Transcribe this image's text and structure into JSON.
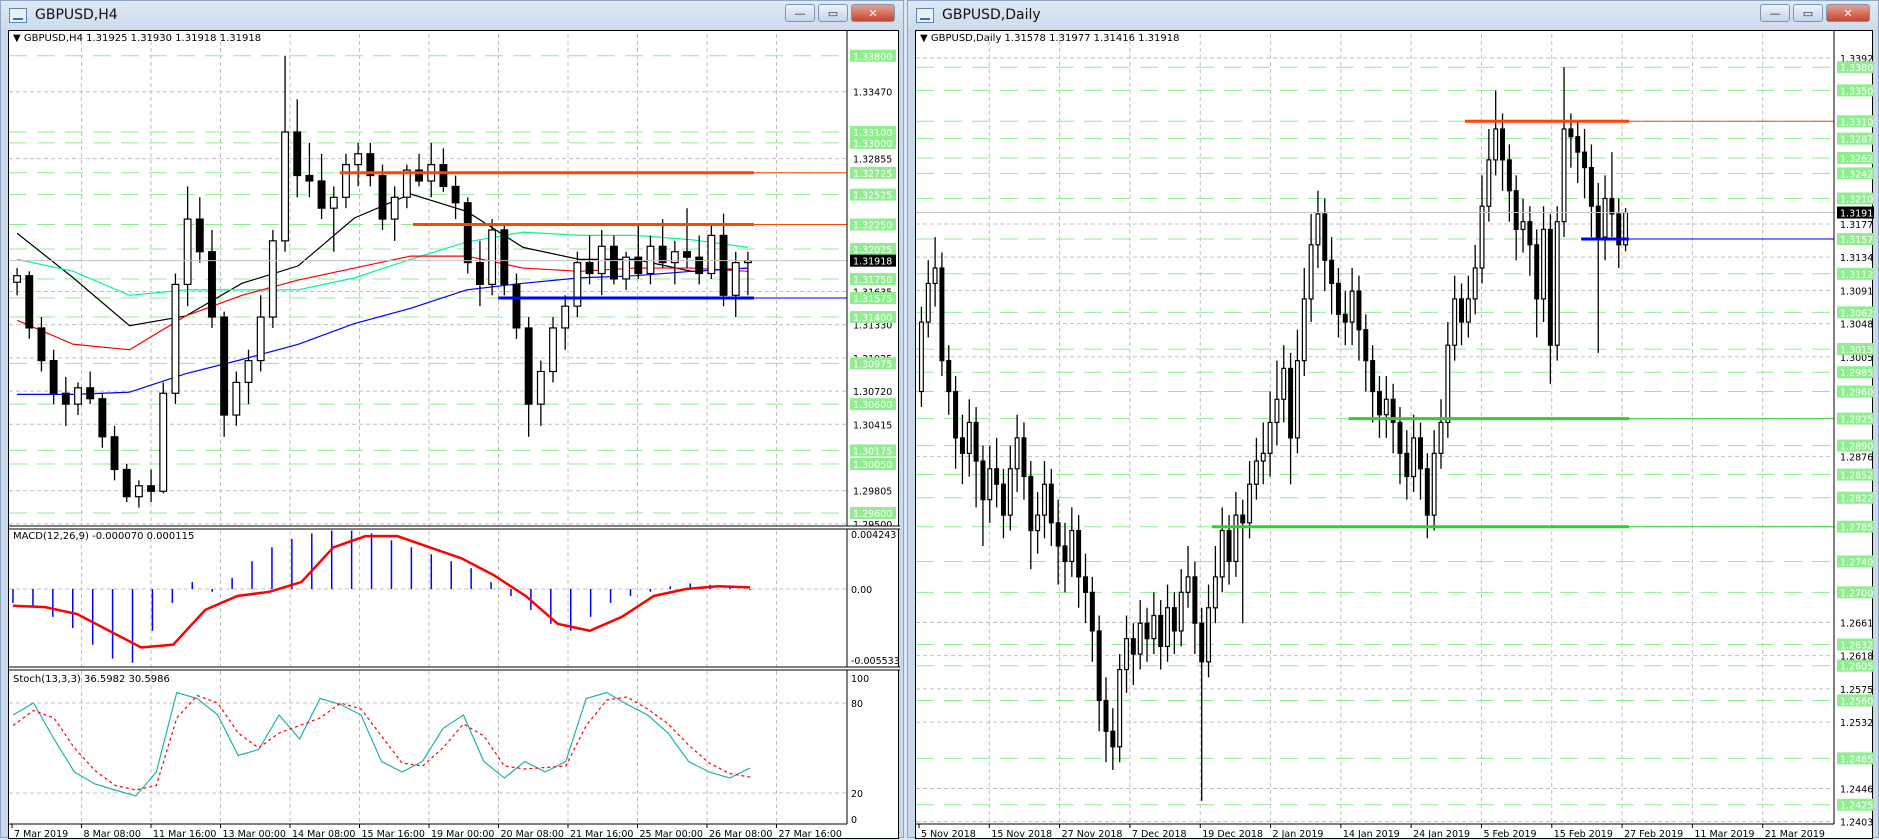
{
  "colors": {
    "bull": "#ffffff",
    "bear": "#000000",
    "level": "#90ee90",
    "grid": "#c0c0c0",
    "orange": "#ff4500",
    "blue": "#0000ff",
    "green": "#32cd32",
    "ma_black": "#000000",
    "ma_teal": "#00fa9a",
    "ma_red": "#ff0000",
    "ma_blue": "#0000ff",
    "macd_hist": "#0000ff",
    "macd_signal": "#ff0000",
    "stoch_main": "#20b2aa",
    "stoch_signal": "#ff0000"
  },
  "h4": {
    "window_title": "GBPUSD,H4",
    "legend": "GBPUSD,H4  1.31925 1.31930 1.31918 1.31918",
    "buttons": {
      "minimize": "—",
      "restore": "▭",
      "close": "✕"
    },
    "chart_data": {
      "type": "candlestick",
      "ylim": [
        1.2949,
        1.34
      ],
      "first_open": 1.3172,
      "close": [
        1.3178,
        1.313,
        1.31,
        1.307,
        1.306,
        1.3075,
        1.3065,
        1.303,
        1.3,
        1.2975,
        1.2985,
        1.298,
        1.307,
        1.317,
        1.323,
        1.32,
        1.314,
        1.305,
        1.308,
        1.31,
        1.314,
        1.321,
        1.331,
        1.327,
        1.3265,
        1.324,
        1.325,
        1.328,
        1.329,
        1.327,
        1.323,
        1.325,
        1.3275,
        1.3265,
        1.328,
        1.326,
        1.3245,
        1.319,
        1.317,
        1.322,
        1.317,
        1.313,
        1.306,
        1.309,
        1.313,
        1.315,
        1.319,
        1.318,
        1.3205,
        1.3175,
        1.3195,
        1.318,
        1.3205,
        1.319,
        1.32,
        1.3195,
        1.318,
        1.3215,
        1.316,
        1.319,
        1.31918
      ],
      "high": [
        1.3185,
        1.3182,
        1.314,
        1.311,
        1.3085,
        1.308,
        1.309,
        1.307,
        1.304,
        1.3005,
        1.299,
        1.3,
        1.308,
        1.318,
        1.326,
        1.325,
        1.322,
        1.3145,
        1.309,
        1.311,
        1.316,
        1.322,
        1.338,
        1.334,
        1.33,
        1.329,
        1.326,
        1.329,
        1.33,
        1.33,
        1.328,
        1.326,
        1.328,
        1.329,
        1.33,
        1.3295,
        1.327,
        1.325,
        1.321,
        1.323,
        1.3225,
        1.318,
        1.314,
        1.31,
        1.314,
        1.316,
        1.32,
        1.3215,
        1.322,
        1.3215,
        1.32,
        1.3225,
        1.3215,
        1.323,
        1.321,
        1.324,
        1.3215,
        1.3225,
        1.3235,
        1.32,
        1.32
      ],
      "low": [
        1.316,
        1.312,
        1.309,
        1.306,
        1.304,
        1.305,
        1.306,
        1.302,
        1.299,
        1.297,
        1.2965,
        1.297,
        1.2978,
        1.306,
        1.315,
        1.319,
        1.313,
        1.303,
        1.304,
        1.306,
        1.309,
        1.313,
        1.32,
        1.325,
        1.325,
        1.323,
        1.32,
        1.324,
        1.326,
        1.326,
        1.322,
        1.321,
        1.324,
        1.326,
        1.325,
        1.3255,
        1.323,
        1.318,
        1.315,
        1.316,
        1.316,
        1.312,
        1.303,
        1.304,
        1.308,
        1.311,
        1.314,
        1.317,
        1.316,
        1.317,
        1.3165,
        1.3175,
        1.317,
        1.3185,
        1.317,
        1.3185,
        1.317,
        1.3175,
        1.315,
        1.314,
        1.316
      ],
      "moving_averages": [
        {
          "name": "ma-black",
          "color": "#000000",
          "values": [
            1.3217,
            1.3176,
            1.3132,
            1.3141,
            1.3171,
            1.3187,
            1.3231,
            1.3253,
            1.3237,
            1.3204,
            1.3193,
            1.3193,
            1.3182,
            1.3185
          ]
        },
        {
          "name": "ma-teal",
          "color": "#00fa9a",
          "values": [
            1.3193,
            1.3182,
            1.316,
            1.3165,
            1.3165,
            1.3165,
            1.3176,
            1.3193,
            1.3209,
            1.3218,
            1.3215,
            1.3215,
            1.3211,
            1.3204
          ]
        },
        {
          "name": "ma-red",
          "color": "#ff0000",
          "values": [
            1.3137,
            1.3115,
            1.311,
            1.3141,
            1.316,
            1.3174,
            1.3185,
            1.3196,
            1.3196,
            1.3185,
            1.3182,
            1.3185,
            1.3185,
            1.3182
          ]
        },
        {
          "name": "ma-blue",
          "color": "#0000ff",
          "values": [
            1.3069,
            1.3069,
            1.3071,
            1.3088,
            1.3101,
            1.3115,
            1.3134,
            1.3148,
            1.3165,
            1.3171,
            1.3176,
            1.3178,
            1.3182,
            1.3185
          ]
        }
      ],
      "hlines": [
        {
          "name": "resistance-line-upper",
          "price": 1.32725,
          "color": "#ff4500",
          "from_index": 27
        },
        {
          "name": "resistance-line-lower",
          "price": 1.3225,
          "color": "#ff4500",
          "from_index": 33
        },
        {
          "name": "support-line",
          "price": 1.31575,
          "color": "#0000ff",
          "from_index": 40
        }
      ],
      "level_labels": [
        "1.33800",
        "1.33100",
        "1.33000",
        "1.32725",
        "1.32525",
        "1.32250",
        "1.32025",
        "1.31750",
        "1.31575",
        "1.31400",
        "1.30975",
        "1.30600",
        "1.30175",
        "1.30050",
        "1.29600"
      ],
      "price_labels": [
        "1.33470",
        "1.32855",
        "1.31635",
        "1.31330",
        "1.31025",
        "1.30720",
        "1.30415",
        "1.29805",
        "1.29500"
      ],
      "current_price": "1.31918",
      "time_labels": [
        "7 Mar 2019",
        "8 Mar 08:00",
        "11 Mar 16:00",
        "13 Mar 00:00",
        "14 Mar 08:00",
        "15 Mar 16:00",
        "19 Mar 00:00",
        "20 Mar 08:00",
        "21 Mar 16:00",
        "25 Mar 00:00",
        "26 Mar 08:00",
        "27 Mar 16:00"
      ]
    },
    "macd": {
      "legend": "MACD(12,26,9) -0.000070 0.000115",
      "ylim": [
        -0.005533,
        0.004243
      ],
      "axis_labels": [
        "0.004243",
        "0.00",
        "-0.005533"
      ],
      "histogram": [
        -0.001,
        -0.0012,
        -0.002,
        -0.0028,
        -0.004,
        -0.005,
        -0.0053,
        -0.003,
        -0.001,
        0.0005,
        -0.0002,
        0.0008,
        0.002,
        0.003,
        0.0036,
        0.004,
        0.0042,
        0.0042,
        0.004,
        0.0035,
        0.003,
        0.0025,
        0.002,
        0.0015,
        0.0005,
        -0.0005,
        -0.0015,
        -0.0025,
        -0.003,
        -0.002,
        -0.001,
        -0.0005,
        -0.0002,
        0.0002,
        0.0004,
        0.0003,
        0.0002,
        -7e-05
      ],
      "signal": [
        -0.0012,
        -0.0013,
        -0.0018,
        -0.003,
        -0.0042,
        -0.004,
        -0.0015,
        -0.0005,
        -0.0002,
        0.0005,
        0.003,
        0.0038,
        0.0038,
        0.003,
        0.0022,
        0.001,
        -0.0005,
        -0.0025,
        -0.003,
        -0.002,
        -0.0005,
        0.0,
        0.0002,
        0.000115
      ]
    },
    "stoch": {
      "legend": "Stoch(13,3,3) 36.5982 30.5986",
      "ylim": [
        0,
        100
      ],
      "axis_labels": [
        "100",
        "80",
        "20",
        "0"
      ],
      "main": [
        72,
        80,
        56,
        34,
        26,
        22,
        18,
        34,
        87,
        83,
        72,
        45,
        49,
        72,
        56,
        83,
        79,
        72,
        41,
        34,
        41,
        63,
        72,
        41,
        30,
        41,
        34,
        41,
        83,
        87,
        79,
        72,
        60,
        41,
        34,
        30,
        36.6
      ],
      "signal": [
        65,
        75,
        70,
        50,
        35,
        25,
        22,
        25,
        70,
        85,
        80,
        60,
        50,
        60,
        65,
        70,
        80,
        76,
        58,
        40,
        38,
        50,
        66,
        58,
        38,
        36,
        37,
        38,
        65,
        82,
        84,
        76,
        66,
        52,
        40,
        33,
        30.6
      ]
    }
  },
  "daily": {
    "window_title": "GBPUSD,Daily",
    "legend": "GBPUSD,Daily  1.31578 1.31977 1.31416 1.31918",
    "buttons": {
      "minimize": "—",
      "restore": "▭",
      "close": "✕"
    },
    "chart_data": {
      "type": "candlestick",
      "ylim": [
        1.24,
        1.3423
      ],
      "first_open": 1.296,
      "close": [
        1.305,
        1.31,
        1.312,
        1.3,
        1.296,
        1.29,
        1.288,
        1.292,
        1.287,
        1.282,
        1.286,
        1.284,
        1.28,
        1.286,
        1.29,
        1.285,
        1.278,
        1.28,
        1.284,
        1.279,
        1.276,
        1.274,
        1.278,
        1.272,
        1.27,
        1.265,
        1.256,
        1.252,
        1.25,
        1.26,
        1.264,
        1.262,
        1.266,
        1.264,
        1.267,
        1.263,
        1.268,
        1.265,
        1.27,
        1.272,
        1.266,
        1.261,
        1.268,
        1.272,
        1.278,
        1.274,
        1.28,
        1.279,
        1.284,
        1.287,
        1.288,
        1.292,
        1.295,
        1.299,
        1.29,
        1.3,
        1.308,
        1.315,
        1.319,
        1.313,
        1.31,
        1.306,
        1.305,
        1.309,
        1.304,
        1.3,
        1.296,
        1.293,
        1.295,
        1.292,
        1.288,
        1.285,
        1.29,
        1.286,
        1.28,
        1.288,
        1.292,
        1.302,
        1.308,
        1.305,
        1.308,
        1.312,
        1.32,
        1.326,
        1.33,
        1.326,
        1.322,
        1.317,
        1.318,
        1.315,
        1.308,
        1.317,
        1.302,
        1.318,
        1.33,
        1.329,
        1.327,
        1.325,
        1.32,
        1.316,
        1.321,
        1.319,
        1.315,
        1.31918
      ],
      "high": [
        1.307,
        1.313,
        1.316,
        1.314,
        1.302,
        1.298,
        1.293,
        1.295,
        1.294,
        1.289,
        1.289,
        1.29,
        1.286,
        1.289,
        1.293,
        1.292,
        1.287,
        1.283,
        1.287,
        1.286,
        1.282,
        1.279,
        1.281,
        1.28,
        1.275,
        1.272,
        1.267,
        1.259,
        1.255,
        1.262,
        1.267,
        1.266,
        1.269,
        1.268,
        1.27,
        1.269,
        1.271,
        1.27,
        1.273,
        1.276,
        1.274,
        1.268,
        1.271,
        1.276,
        1.281,
        1.28,
        1.283,
        1.282,
        1.287,
        1.29,
        1.292,
        1.296,
        1.3,
        1.302,
        1.301,
        1.304,
        1.312,
        1.319,
        1.322,
        1.321,
        1.316,
        1.312,
        1.309,
        1.312,
        1.311,
        1.306,
        1.302,
        1.298,
        1.298,
        1.297,
        1.294,
        1.291,
        1.293,
        1.292,
        1.288,
        1.291,
        1.295,
        1.305,
        1.311,
        1.31,
        1.311,
        1.315,
        1.324,
        1.33,
        1.335,
        1.332,
        1.328,
        1.324,
        1.321,
        1.32,
        1.317,
        1.32,
        1.319,
        1.32,
        1.338,
        1.332,
        1.331,
        1.33,
        1.328,
        1.323,
        1.324,
        1.327,
        1.321,
        1.31977
      ],
      "low": [
        1.294,
        1.303,
        1.307,
        1.298,
        1.293,
        1.286,
        1.284,
        1.285,
        1.281,
        1.276,
        1.279,
        1.281,
        1.277,
        1.278,
        1.283,
        1.282,
        1.273,
        1.275,
        1.277,
        1.276,
        1.271,
        1.27,
        1.272,
        1.268,
        1.266,
        1.261,
        1.252,
        1.248,
        1.247,
        1.248,
        1.257,
        1.258,
        1.26,
        1.261,
        1.262,
        1.26,
        1.261,
        1.262,
        1.263,
        1.268,
        1.262,
        1.243,
        1.259,
        1.266,
        1.27,
        1.271,
        1.272,
        1.266,
        1.277,
        1.282,
        1.284,
        1.285,
        1.289,
        1.292,
        1.284,
        1.288,
        1.298,
        1.305,
        1.312,
        1.309,
        1.306,
        1.303,
        1.302,
        1.302,
        1.3,
        1.296,
        1.292,
        1.29,
        1.29,
        1.288,
        1.284,
        1.282,
        1.283,
        1.282,
        1.277,
        1.278,
        1.286,
        1.29,
        1.3,
        1.302,
        1.303,
        1.306,
        1.31,
        1.318,
        1.324,
        1.322,
        1.318,
        1.313,
        1.314,
        1.311,
        1.303,
        1.305,
        1.297,
        1.3,
        1.316,
        1.325,
        1.323,
        1.321,
        1.316,
        1.301,
        1.313,
        1.316,
        1.312,
        1.31416
      ],
      "hlines": [
        {
          "name": "resistance-line",
          "price": 1.331,
          "color": "#ff4500",
          "from_index": 80
        },
        {
          "name": "support-line-blue",
          "price": 1.31575,
          "color": "#0000ff",
          "from_index": 97
        },
        {
          "name": "support-line-green-upper",
          "price": 1.2925,
          "color": "#32cd32",
          "from_index": 63
        },
        {
          "name": "support-line-green-lower",
          "price": 1.2785,
          "color": "#32cd32",
          "from_index": 43
        }
      ],
      "level_labels": [
        "1.33800",
        "1.33500",
        "1.33100",
        "1.32875",
        "1.32625",
        "1.32425",
        "1.32100",
        "1.31575",
        "1.31125",
        "1.30625",
        "1.30150",
        "1.29850",
        "1.29600",
        "1.29250",
        "1.28900",
        "1.28525",
        "1.28225",
        "1.27850",
        "1.27400",
        "1.27000",
        "1.26325",
        "1.26050",
        "1.25600",
        "1.24850",
        "1.24250"
      ],
      "price_labels": [
        "1.33920",
        "1.31770",
        "1.31340",
        "1.30910",
        "1.30480",
        "1.30050",
        "1.28760",
        "1.26610",
        "1.26180",
        "1.25750",
        "1.25320",
        "1.24460",
        "1.24030"
      ],
      "current_price": "1.31918",
      "time_labels": [
        "5 Nov 2018",
        "15 Nov 2018",
        "27 Nov 2018",
        "7 Dec 2018",
        "19 Dec 2018",
        "2 Jan 2019",
        "14 Jan 2019",
        "24 Jan 2019",
        "5 Feb 2019",
        "15 Feb 2019",
        "27 Feb 2019",
        "11 Mar 2019",
        "21 Mar 2019"
      ]
    }
  }
}
